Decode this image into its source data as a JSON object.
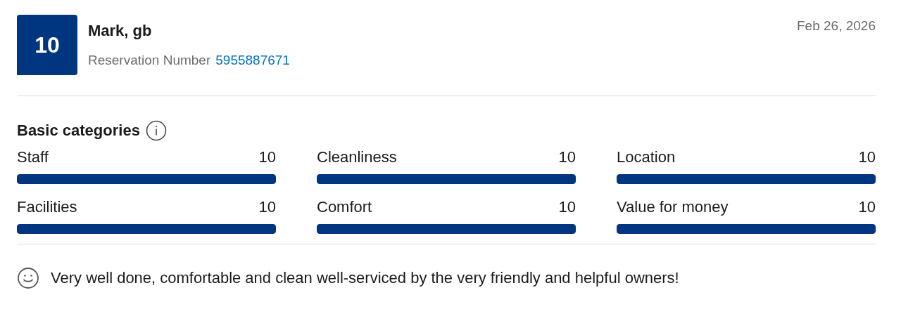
{
  "review": {
    "score": "10",
    "name": "Mark, gb",
    "reservation_label": "Reservation Number",
    "reservation_number": "5955887671",
    "date": "Feb 26, 2026"
  },
  "categories_title": "Basic categories",
  "categories": [
    {
      "name": "Staff",
      "score": "10",
      "level": 1
    },
    {
      "name": "Cleanliness",
      "score": "10",
      "level": 1
    },
    {
      "name": "Location",
      "score": "10",
      "level": 1
    },
    {
      "name": "Facilities",
      "score": "10",
      "level": 1
    },
    {
      "name": "Comfort",
      "score": "10",
      "level": 1
    },
    {
      "name": "Value for money",
      "score": "10",
      "level": 1
    }
  ],
  "comment": {
    "text": "Very well done, comfortable and clean well-serviced by the very friendly and helpful owners!"
  }
}
